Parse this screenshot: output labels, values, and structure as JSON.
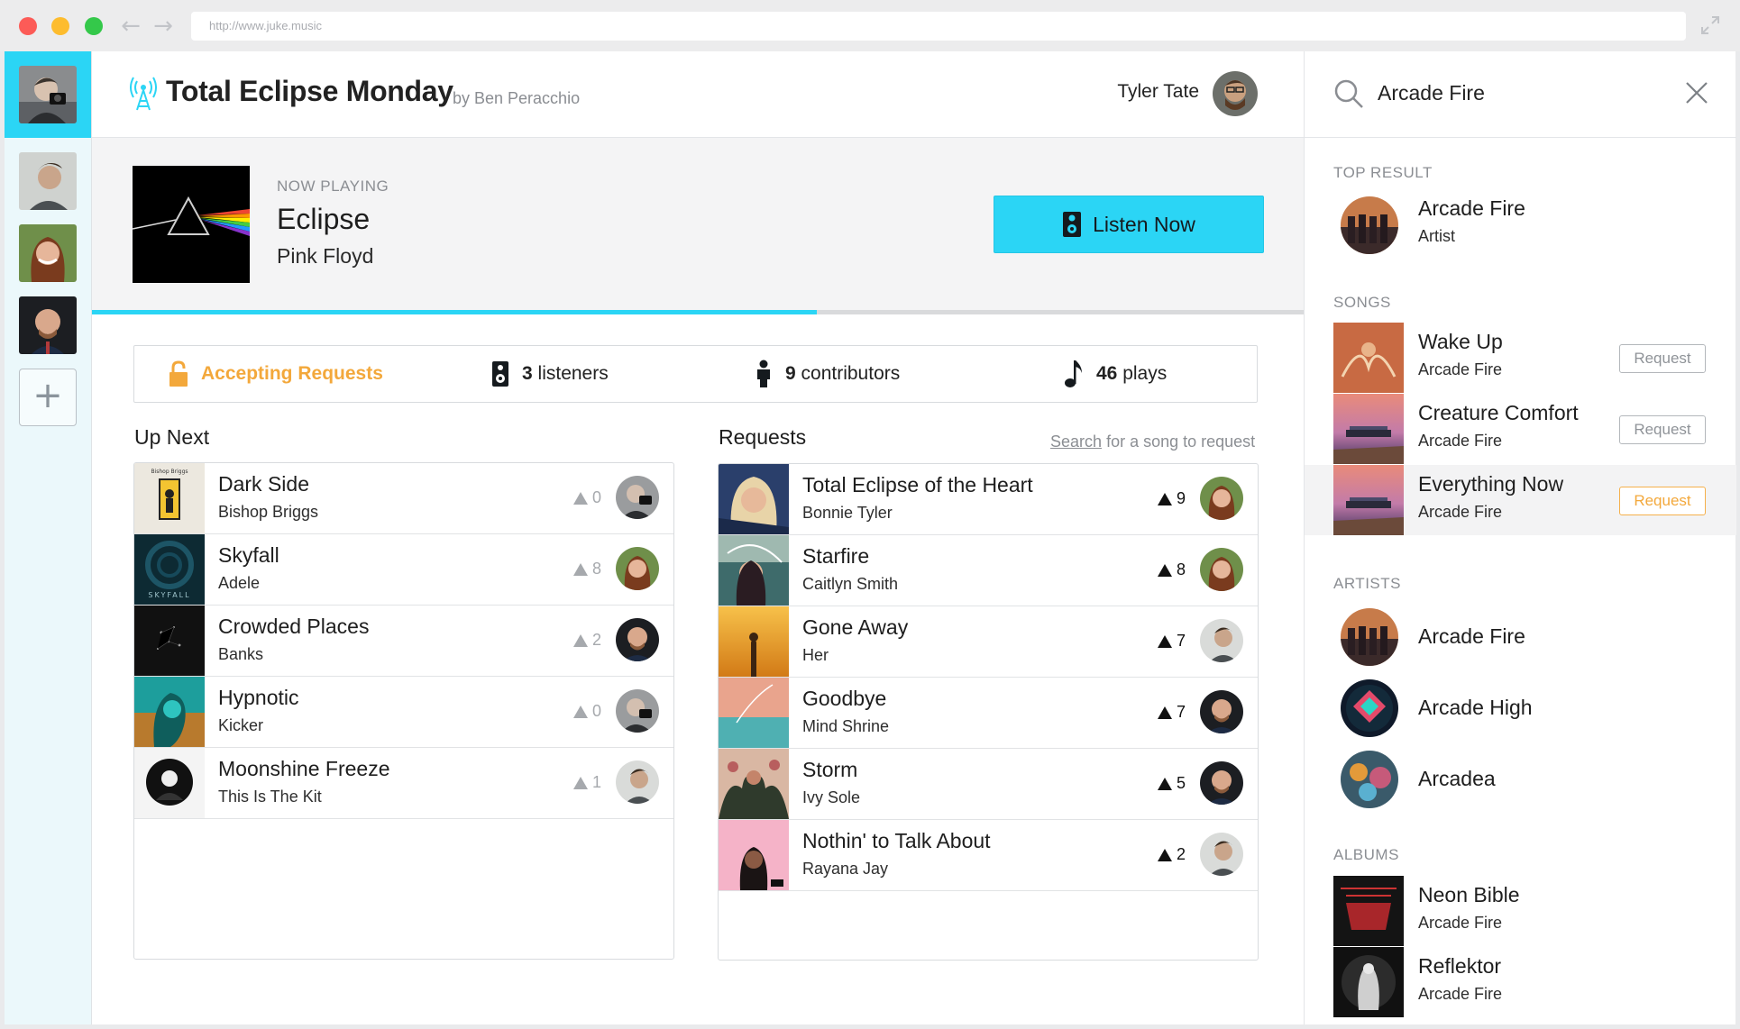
{
  "browser": {
    "url": "http://www.juke.music"
  },
  "header": {
    "room_title": "Total Eclipse Monday",
    "room_by": "by Ben Peracchio",
    "user_name": "Tyler Tate"
  },
  "now_playing": {
    "label": "NOW PLAYING",
    "title": "Eclipse",
    "artist": "Pink Floyd",
    "listen_label": "Listen Now",
    "progress": 0.598
  },
  "stats": {
    "accepting": "Accepting Requests",
    "listeners_count": "3",
    "listeners_label": "listeners",
    "contributors_count": "9",
    "contributors_label": "contributors",
    "plays_count": "46",
    "plays_label": "plays"
  },
  "up_next": {
    "title": "Up Next",
    "items": [
      {
        "title": "Dark Side",
        "artist": "Bishop Briggs",
        "votes": "0"
      },
      {
        "title": "Skyfall",
        "artist": "Adele",
        "votes": "8"
      },
      {
        "title": "Crowded Places",
        "artist": "Banks",
        "votes": "2"
      },
      {
        "title": "Hypnotic",
        "artist": "Kicker",
        "votes": "0"
      },
      {
        "title": "Moonshine Freeze",
        "artist": "This Is The Kit",
        "votes": "1"
      }
    ]
  },
  "requests": {
    "title": "Requests",
    "search_link": "Search",
    "search_hint": "for a song to request",
    "items": [
      {
        "title": "Total Eclipse of the Heart",
        "artist": "Bonnie Tyler",
        "votes": "9"
      },
      {
        "title": "Starfire",
        "artist": "Caitlyn Smith",
        "votes": "8"
      },
      {
        "title": "Gone Away",
        "artist": "Her",
        "votes": "7"
      },
      {
        "title": "Goodbye",
        "artist": "Mind Shrine",
        "votes": "7"
      },
      {
        "title": "Storm",
        "artist": "Ivy Sole",
        "votes": "5"
      },
      {
        "title": "Nothin' to Talk About",
        "artist": "Rayana Jay",
        "votes": "2"
      }
    ]
  },
  "search": {
    "query": "Arcade Fire",
    "top_result_label": "TOP RESULT",
    "top_result": {
      "title": "Arcade Fire",
      "type": "Artist"
    },
    "songs_label": "SONGS",
    "songs": [
      {
        "title": "Wake Up",
        "artist": "Arcade Fire",
        "button": "Request"
      },
      {
        "title": "Creature Comfort",
        "artist": "Arcade Fire",
        "button": "Request"
      },
      {
        "title": "Everything Now",
        "artist": "Arcade Fire",
        "button": "Request"
      }
    ],
    "artists_label": "ARTISTS",
    "artists": [
      {
        "name": "Arcade Fire"
      },
      {
        "name": "Arcade High"
      },
      {
        "name": "Arcadea"
      }
    ],
    "albums_label": "ALBUMS",
    "albums": [
      {
        "title": "Neon Bible",
        "artist": "Arcade Fire"
      },
      {
        "title": "Reflektor",
        "artist": "Arcade Fire"
      }
    ]
  },
  "colors": {
    "accent": "#2bd5f5",
    "accepting": "#f3a83b",
    "rail_bg": "#ebf8fb"
  }
}
